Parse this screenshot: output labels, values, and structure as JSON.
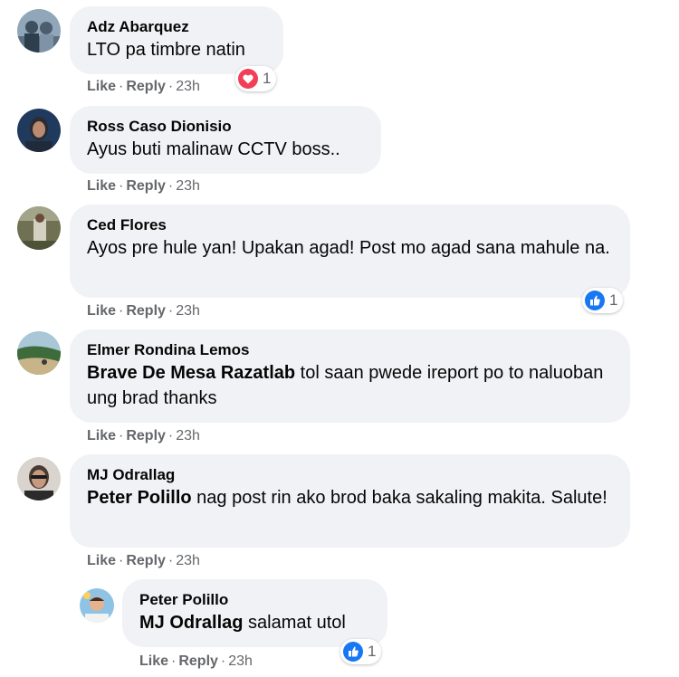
{
  "comments": [
    {
      "author": "Adz Abarquez",
      "mention": "",
      "text": "LTO pa timbre natin",
      "actions": {
        "like": "Like",
        "reply": "Reply",
        "time": "23h"
      },
      "reaction": {
        "icon": "heart-reaction-icon",
        "count": "1"
      }
    },
    {
      "author": "Ross Caso Dionisio",
      "mention": "",
      "text": "Ayus buti malinaw CCTV boss..",
      "actions": {
        "like": "Like",
        "reply": "Reply",
        "time": "23h"
      }
    },
    {
      "author": "Ced Flores",
      "mention": "",
      "text": "Ayos pre hule yan! Upakan agad! Post mo agad sana mahule na.",
      "actions": {
        "like": "Like",
        "reply": "Reply",
        "time": "23h"
      },
      "reaction": {
        "icon": "like-reaction-icon",
        "count": "1"
      }
    },
    {
      "author": "Elmer Rondina Lemos",
      "mention": "Brave De Mesa Razatlab",
      "text": " tol saan pwede ireport po to naluoban ung brad thanks",
      "actions": {
        "like": "Like",
        "reply": "Reply",
        "time": "23h"
      }
    },
    {
      "author": "MJ Odrallag",
      "mention": "Peter Polillo",
      "text": " nag post rin ako brod baka sakaling makita. Salute!",
      "actions": {
        "like": "Like",
        "reply": "Reply",
        "time": "23h"
      }
    },
    {
      "author": "Peter Polillo",
      "mention": "MJ Odrallag",
      "text": " salamat utol",
      "actions": {
        "like": "Like",
        "reply": "Reply",
        "time": "23h"
      },
      "reaction": {
        "icon": "like-reaction-icon",
        "count": "1"
      }
    }
  ],
  "colors": {
    "bubble_bg": "#f0f2f5",
    "meta_text": "#65676b",
    "like_blue": "#1877f2",
    "love_red": "#f33e58"
  }
}
